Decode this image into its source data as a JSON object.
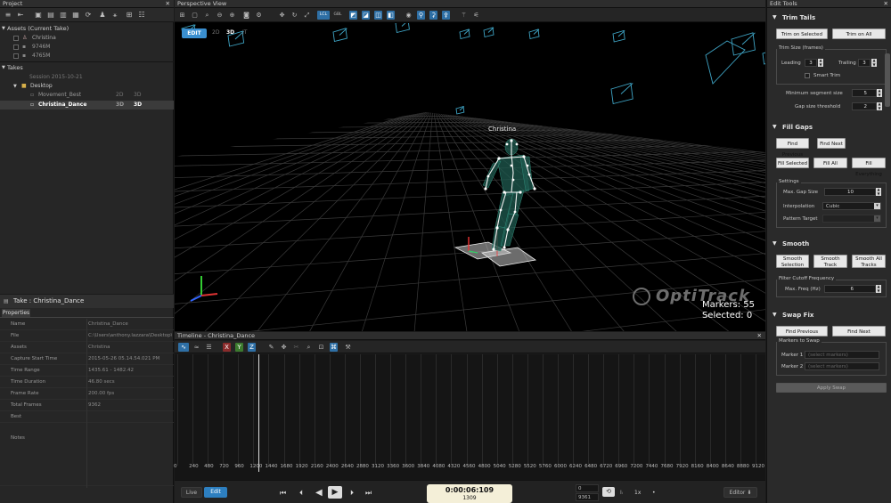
{
  "project": {
    "title": "Project",
    "assets_header": "Assets (Current Take)",
    "assets": [
      "Christina",
      "9746M",
      "4765M"
    ],
    "takes_header": "Takes",
    "session": "Session 2015-10-21",
    "folder": "Desktop",
    "takes": [
      {
        "name": "Movement_Best",
        "tag2d": "2D",
        "tag3d": "3D"
      },
      {
        "name": "Christina_Dance",
        "tag2d": "3D",
        "tag3d": "3D"
      }
    ]
  },
  "take_panel": {
    "title": "Take : Christina_Dance",
    "tab": "Properties",
    "props": [
      {
        "k": "Name",
        "v": "Christina_Dance"
      },
      {
        "k": "File",
        "v": "C:\\Users\\anthony.lazzara\\Desktop\\C"
      },
      {
        "k": "Assets",
        "v": "Christina"
      },
      {
        "k": "Capture Start Time",
        "v": "2015-05-26 05.14.54.021 PM"
      },
      {
        "k": "Time Range",
        "v": "1435.61 - 1482.42"
      },
      {
        "k": "Time Duration",
        "v": "46.80 secs"
      },
      {
        "k": "Frame Rate",
        "v": "200.00 fps"
      },
      {
        "k": "Total Frames",
        "v": "9362"
      },
      {
        "k": "Best",
        "v": ""
      },
      {
        "k": "Notes",
        "v": ""
      }
    ]
  },
  "perspective": {
    "title": "Perspective View",
    "mode_edit": "EDIT",
    "mode_2d": "2D",
    "mode_3d": "3D",
    "mode_other": "JT",
    "actor_name": "Christina",
    "markers_label": "Markers: 55",
    "selected_label": "Selected: 0",
    "logo_text": "OptiTrack",
    "toolbar_lcl": "LCL",
    "toolbar_gbl": "GBL"
  },
  "timeline": {
    "title": "Timeline - Christina_Dance",
    "ticks": [
      "0",
      "240",
      "480",
      "720",
      "960",
      "1200",
      "1440",
      "1680",
      "1920",
      "2160",
      "2400",
      "2640",
      "2880",
      "3120",
      "3360",
      "3600",
      "3840",
      "4080",
      "4320",
      "4560",
      "4800",
      "5040",
      "5280",
      "5520",
      "5760",
      "6000",
      "6240",
      "6480",
      "6720",
      "6960",
      "7200",
      "7440",
      "7680",
      "7920",
      "8160",
      "8400",
      "8640",
      "8880",
      "9120"
    ],
    "live_label": "Live",
    "edit_label": "Edit",
    "timecode": "0:00:06:109",
    "frame": "1309",
    "range_start": "0",
    "range_end": "9361",
    "speed": "1x",
    "editor_label": "Editor"
  },
  "edit_tools": {
    "title": "Edit Tools",
    "trim_tails": "Trim Tails",
    "trim_on_selected": "Trim on Selected",
    "trim_on_all": "Trim on All",
    "trim_size_group": "Trim Size (frames)",
    "leading_label": "Leading",
    "leading_value": "3",
    "trailing_label": "Trailing",
    "trailing_value": "3",
    "smart_trim": "Smart Trim",
    "min_segment_label": "Minimum segment size",
    "min_segment_value": "5",
    "gap_threshold_label": "Gap size threshold",
    "gap_threshold_value": "2",
    "fill_gaps": "Fill Gaps",
    "find_previous": "Find Previous",
    "find_next": "Find Next",
    "fill_selected": "Fill Selected",
    "fill_all": "Fill All",
    "fill_everything": "Fill Everything",
    "settings_group": "Settings",
    "max_gap_label": "Max. Gap Size",
    "max_gap_value": "10",
    "interp_label": "Interpolation",
    "interp_value": "Cubic",
    "pattern_label": "Pattern Target",
    "smooth": "Smooth",
    "smooth_selection": "Smooth Selection",
    "smooth_track": "Smooth Track",
    "smooth_all": "Smooth All Tracks",
    "filter_group": "Filter Cutoff Frequency",
    "max_freq_label": "Max. Freq (Hz)",
    "max_freq_value": "6",
    "swap_fix": "Swap Fix",
    "swap_find_prev": "Find Previous",
    "swap_find_next": "Find Next",
    "markers_group": "Markers to Swap",
    "marker1_label": "Marker 1",
    "marker2_label": "Marker 2",
    "marker_placeholder": "(select markers)",
    "apply_swap": "Apply Swap"
  }
}
